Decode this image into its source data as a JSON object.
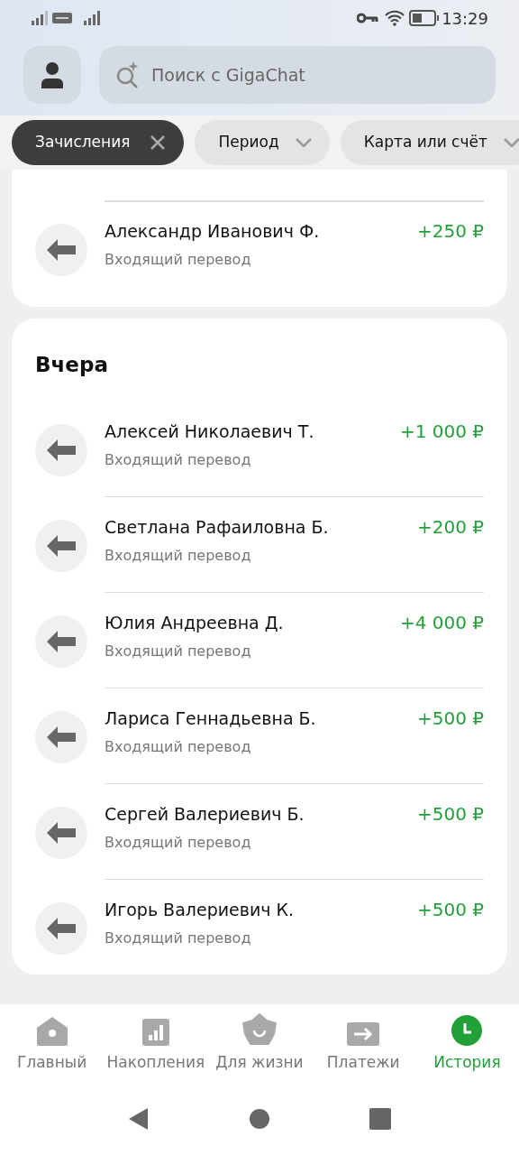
{
  "status_bar": {
    "time": "13:29"
  },
  "search": {
    "placeholder": "Поиск с GigaChat"
  },
  "filters": [
    {
      "label": "Зачисления",
      "selected": true
    },
    {
      "label": "Период",
      "selected": false
    },
    {
      "label": "Карта или счёт",
      "selected": false
    }
  ],
  "groups": [
    {
      "transactions": [
        {
          "name": "Александр Иванович Ф.",
          "type": "Входящий перевод",
          "amount": "+250 ₽"
        }
      ]
    },
    {
      "title": "Вчера",
      "transactions": [
        {
          "name": "Алексей Николаевич Т.",
          "type": "Входящий перевод",
          "amount": "+1 000 ₽"
        },
        {
          "name": "Светлана Рафаиловна Б.",
          "type": "Входящий перевод",
          "amount": "+200 ₽"
        },
        {
          "name": "Юлия Андреевна Д.",
          "type": "Входящий перевод",
          "amount": "+4 000 ₽"
        },
        {
          "name": "Лариса Геннадьевна Б.",
          "type": "Входящий перевод",
          "amount": "+500 ₽"
        },
        {
          "name": "Сергей Валериевич Б.",
          "type": "Входящий перевод",
          "amount": "+500 ₽"
        },
        {
          "name": "Игорь Валериевич К.",
          "type": "Входящий перевод",
          "amount": "+500 ₽"
        }
      ]
    }
  ],
  "nav": [
    {
      "label": "Главный",
      "kind": "home",
      "selected": false
    },
    {
      "label": "Накопления",
      "kind": "savings",
      "selected": false
    },
    {
      "label": "Для жизни",
      "kind": "life",
      "selected": false
    },
    {
      "label": "Платежи",
      "kind": "payments",
      "selected": false
    },
    {
      "label": "История",
      "kind": "history",
      "selected": true
    }
  ]
}
